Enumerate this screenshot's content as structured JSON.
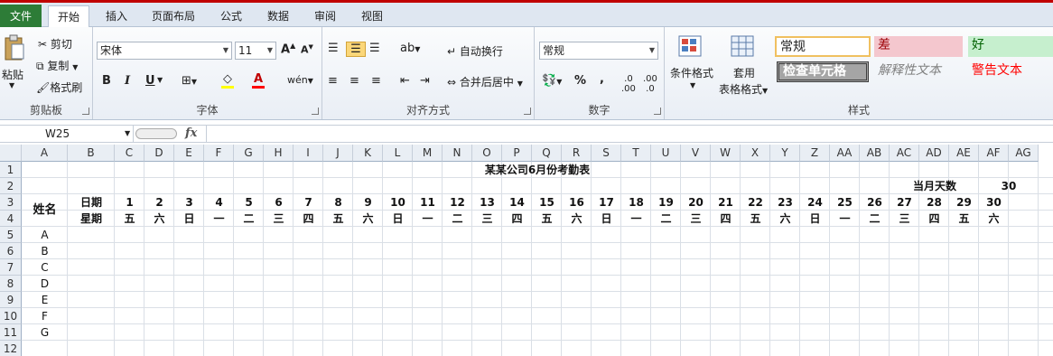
{
  "tabs": {
    "file": "文件",
    "home": "开始",
    "insert": "插入",
    "layout": "页面布局",
    "formula": "公式",
    "data": "数据",
    "review": "审阅",
    "view": "视图"
  },
  "clipboard": {
    "paste": "粘贴",
    "cut": "剪切",
    "copy": "复制",
    "format_painter": "格式刷",
    "label": "剪贴板"
  },
  "font": {
    "name": "宋体",
    "size": "11",
    "label": "字体",
    "bold": "B",
    "italic": "I",
    "underline": "U"
  },
  "alignment": {
    "wrap": "自动换行",
    "merge": "合并后居中",
    "label": "对齐方式"
  },
  "number": {
    "format": "常规",
    "percent": "%",
    "comma": ",",
    "label": "数字"
  },
  "styles": {
    "cond_format": "条件格式",
    "table_format_1": "套用",
    "table_format_2": "表格格式",
    "normal": "常规",
    "bad": "差",
    "good": "好",
    "check_cell": "检查单元格",
    "explanatory": "解释性文本",
    "warning": "警告文本",
    "label": "样式",
    "colors": {
      "bad_bg": "#f4c7ce",
      "good_bg": "#c6efce",
      "check_bg": "#a5a5a5"
    }
  },
  "formula_bar": {
    "name_box": "W25",
    "fx": "fx",
    "formula": ""
  },
  "columns": [
    "A",
    "B",
    "C",
    "D",
    "E",
    "F",
    "G",
    "H",
    "I",
    "J",
    "K",
    "L",
    "M",
    "N",
    "O",
    "P",
    "Q",
    "R",
    "S",
    "T",
    "U",
    "V",
    "W",
    "X",
    "Y",
    "Z",
    "AA",
    "AB",
    "AC",
    "AD",
    "AE",
    "AF",
    "AG"
  ],
  "rows": [
    "1",
    "2",
    "3",
    "4",
    "5",
    "6",
    "7",
    "8",
    "9",
    "10",
    "11",
    "12"
  ],
  "sheet": {
    "title": "某某公司6月份考勤表",
    "days_label": "当月天数",
    "days_value": "30",
    "name_header": "姓名",
    "date_label": "日期",
    "weekday_label": "星期",
    "days": [
      "1",
      "2",
      "3",
      "4",
      "5",
      "6",
      "7",
      "8",
      "9",
      "10",
      "11",
      "12",
      "13",
      "14",
      "15",
      "16",
      "17",
      "18",
      "19",
      "20",
      "21",
      "22",
      "23",
      "24",
      "25",
      "26",
      "27",
      "28",
      "29",
      "30"
    ],
    "weekdays": [
      "五",
      "六",
      "日",
      "一",
      "二",
      "三",
      "四",
      "五",
      "六",
      "日",
      "一",
      "二",
      "三",
      "四",
      "五",
      "六",
      "日",
      "一",
      "二",
      "三",
      "四",
      "五",
      "六",
      "日",
      "一",
      "二",
      "三",
      "四",
      "五",
      "六"
    ],
    "names": [
      "A",
      "B",
      "C",
      "D",
      "E",
      "F",
      "G"
    ]
  }
}
